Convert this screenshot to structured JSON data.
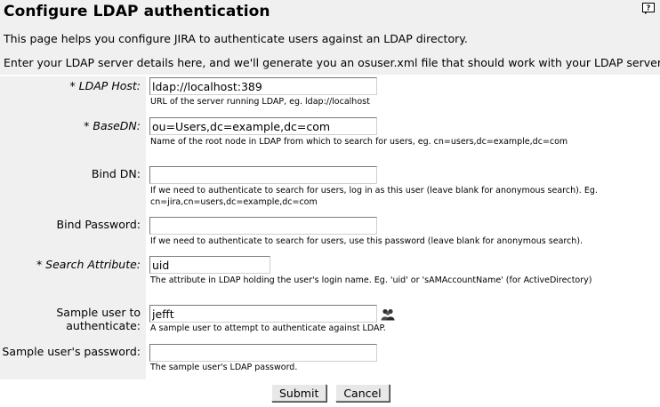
{
  "page": {
    "title": "Configure LDAP authentication",
    "intro_1": "This page helps you configure JIRA to authenticate users against an LDAP directory.",
    "intro_2": "Enter your LDAP server details here, and we'll generate you an osuser.xml file that should work with your LDAP server."
  },
  "form": {
    "ldap_host": {
      "label": "* LDAP Host:",
      "value": "ldap://localhost:389",
      "description": "URL of the server running LDAP, eg. ldap://localhost"
    },
    "base_dn": {
      "label": "* BaseDN:",
      "value": "ou=Users,dc=example,dc=com",
      "description": "Name of the root node in LDAP from which to search for users, eg. cn=users,dc=example,dc=com"
    },
    "bind_dn": {
      "label": "Bind DN:",
      "value": "",
      "description_1": "If we need to authenticate to search for users, log in as this user (leave blank for anonymous search). Eg.",
      "description_2": "cn=jira,cn=users,dc=example,dc=com"
    },
    "bind_password": {
      "label": "Bind Password:",
      "value": "",
      "description": "If we need to authenticate to search for users, use this password (leave blank for anonymous search)."
    },
    "search_attribute": {
      "label": "* Search Attribute:",
      "value": "uid",
      "description": "The attribute in LDAP holding the user's login name. Eg. 'uid' or 'sAMAccountName' (for ActiveDirectory)"
    },
    "sample_user": {
      "label_1": "Sample user to",
      "label_2": "authenticate:",
      "value": "jefft",
      "description": "A sample user to attempt to authenticate against LDAP."
    },
    "sample_password": {
      "label": "Sample user's password:",
      "value": "",
      "description": "The sample user's LDAP password."
    }
  },
  "buttons": {
    "submit": "Submit",
    "cancel": "Cancel"
  },
  "icons": {
    "help": "help-icon",
    "user_picker": "user-picker-icon"
  }
}
